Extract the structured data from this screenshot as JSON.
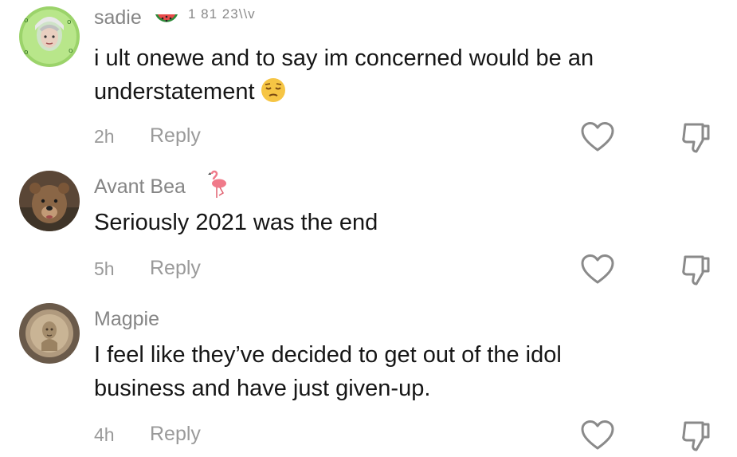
{
  "comments": [
    {
      "username": "sadie",
      "badge_text": "1 81 23\\\\v",
      "badge_icon": "watermelon-icon",
      "text_line1": "i ult onewe and to say im concerned would be an",
      "text_line2": "understatement",
      "text_emoji": "pensive-face-icon",
      "time": "2h",
      "reply_label": "Reply"
    },
    {
      "username": "Avant Bea",
      "badge_icon": "flamingo-icon",
      "text_line1": "Seriously 2021 was the end",
      "time": "5h",
      "reply_label": "Reply"
    },
    {
      "username": "Magpie",
      "text_line1": "I feel like they’ve decided to get out of the idol",
      "text_line2": "business and have just given-up.",
      "time": "4h",
      "reply_label": "Reply"
    }
  ],
  "colors": {
    "username": "#858585",
    "text": "#161616",
    "meta": "#9a9a9a",
    "icon": "#8a8a8a"
  }
}
